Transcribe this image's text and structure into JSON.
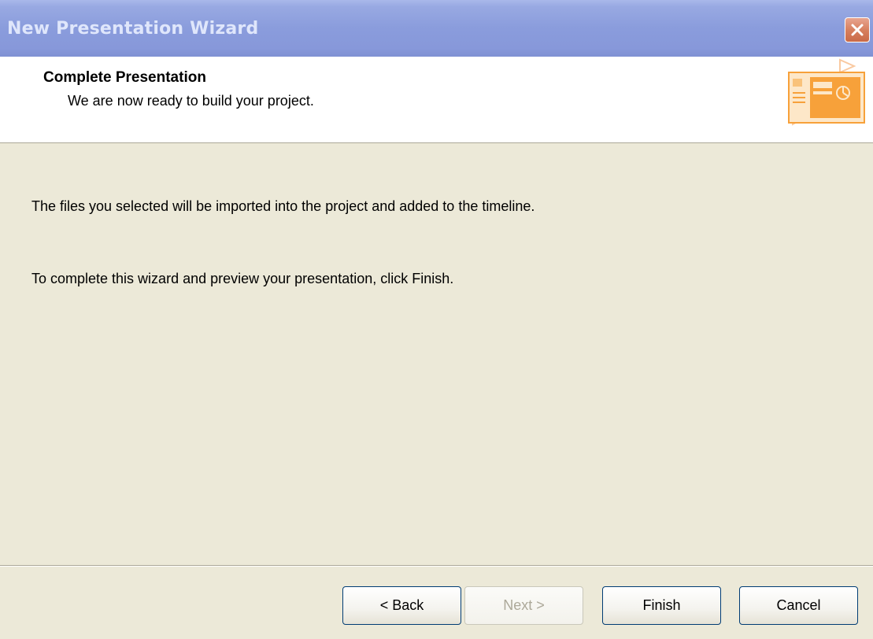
{
  "window": {
    "title": "New Presentation Wizard"
  },
  "header": {
    "title": "Complete Presentation",
    "subtitle": "We are now ready to build your project.",
    "icon": "presentation-slide-icon"
  },
  "content": {
    "line1": "The files you selected will be imported into the project and added to the timeline.",
    "line2": "To complete this wizard and preview your presentation, click Finish."
  },
  "buttons": {
    "back": "< Back",
    "next": "Next >",
    "finish": "Finish",
    "cancel": "Cancel"
  },
  "colors": {
    "titlebar": "#8a9cdc",
    "close_button": "#d7805f",
    "dialog_background": "#ece9d8",
    "header_background": "#ffffff",
    "icon_accent": "#f7a13a"
  }
}
